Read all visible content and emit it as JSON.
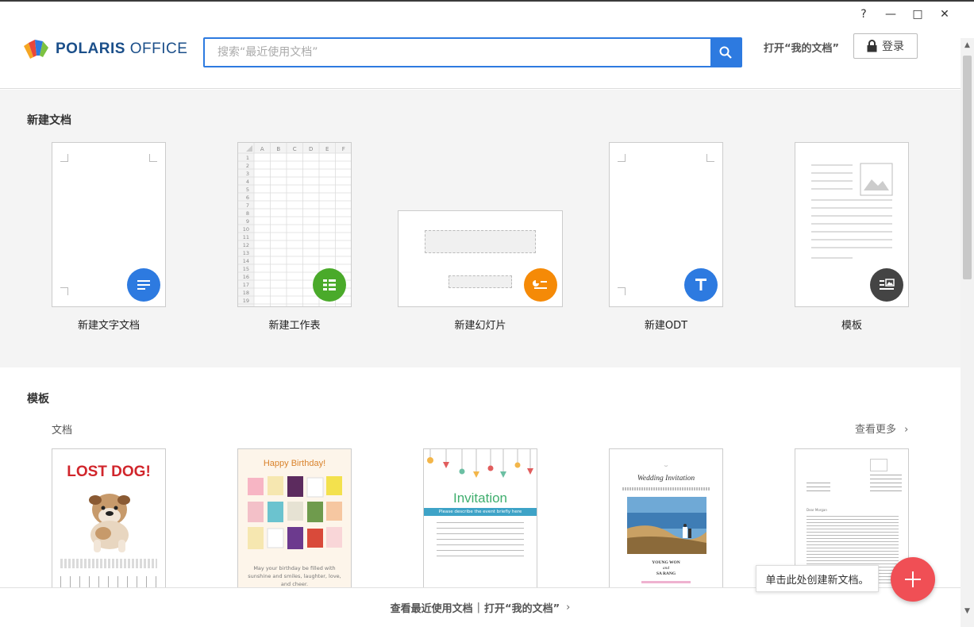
{
  "window": {
    "help": "?",
    "minimize": "—",
    "maximize": "□",
    "close": "✕"
  },
  "header": {
    "logo_brand": "POLARIS",
    "logo_product": " OFFICE",
    "search_placeholder": "搜索“最近使用文档”",
    "open_my_docs": "打开“我的文档”",
    "login_label": "登录"
  },
  "new_section": {
    "title": "新建文档",
    "items": [
      {
        "label": "新建文字文档",
        "icon": "document-lines-icon",
        "color": "#2d7ae0"
      },
      {
        "label": "新建工作表",
        "icon": "spreadsheet-grid-icon",
        "color": "#4aaa2a"
      },
      {
        "label": "新建幻灯片",
        "icon": "slides-icon",
        "color": "#f58a07"
      },
      {
        "label": "新建ODT",
        "icon": "text-t-icon",
        "color": "#2d7ae0"
      },
      {
        "label": "模板",
        "icon": "template-icon",
        "color": "#444444"
      }
    ],
    "sheet_cols": [
      "A",
      "B",
      "C",
      "D",
      "E",
      "F"
    ],
    "sheet_rows": [
      "1",
      "2",
      "3",
      "4",
      "5",
      "6",
      "7",
      "8",
      "9",
      "10",
      "11",
      "12",
      "13",
      "14",
      "15",
      "16",
      "17",
      "18",
      "19"
    ]
  },
  "templates": {
    "title": "模板",
    "subtitle": "文档",
    "see_more": "查看更多",
    "items": [
      {
        "heading": "LOST DOG!"
      },
      {
        "heading": "Happy Birthday!",
        "body": "May your birthday be filled with sunshine and smiles, laughter, love, and cheer."
      },
      {
        "heading": "Invitation",
        "banner": "Please describe the event briefly here"
      },
      {
        "heading": "Wedding Invitation",
        "names": "YOUNG WON",
        "and": "and",
        "names2": "SA RANG"
      },
      {
        "heading": "Dear Morgan"
      }
    ]
  },
  "bottom": {
    "recent": "查看最近使用文档",
    "separator": "|",
    "open_my_docs": "打开“我的文档”"
  },
  "tooltip": "单击此处创建新文档。",
  "colors": {
    "accent": "#2d7ae0",
    "fab": "#f04f55"
  }
}
